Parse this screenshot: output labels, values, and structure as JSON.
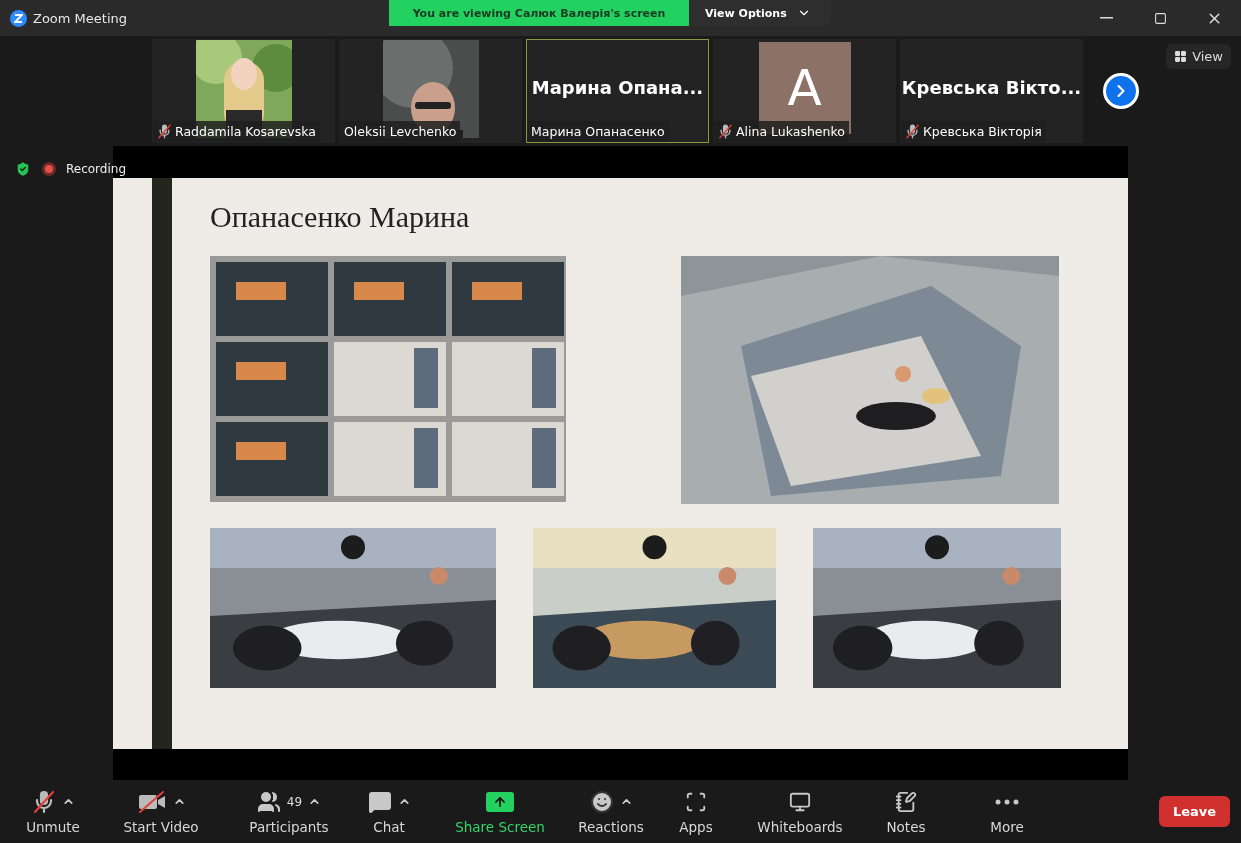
{
  "window": {
    "title": "Zoom Meeting"
  },
  "banner": {
    "text": "You are viewing Салюк Валерія's screen",
    "options_label": "View Options"
  },
  "participants": [
    {
      "name": "Raddamila Kosarevska",
      "muted": true,
      "speaking": false
    },
    {
      "name": "Oleksii Levchenko",
      "muted": false,
      "speaking": false
    },
    {
      "name": "Марина Опанасенко",
      "kind": "name",
      "display": "Марина  Опана...",
      "muted": false,
      "speaking": true
    },
    {
      "name": "Alina Lukashenko",
      "kind": "avatar",
      "display": "A",
      "color": "#8c7167",
      "muted": true,
      "speaking": false
    },
    {
      "name": "Кревська Вікторія",
      "kind": "name",
      "display": "Кревська  Вікто...",
      "muted": true,
      "speaking": false
    }
  ],
  "view_button": "View",
  "recording": {
    "label": "Recording"
  },
  "slide": {
    "title": "Опанасенко Марина"
  },
  "toolbar": [
    {
      "label": "Unmute",
      "kind": "mic",
      "off": true,
      "caret": true
    },
    {
      "label": "Start Video",
      "kind": "video",
      "off": true,
      "caret": true
    },
    {
      "label": "Participants",
      "kind": "people",
      "count": "49",
      "caret": true
    },
    {
      "label": "Chat",
      "kind": "chat",
      "caret": true
    },
    {
      "label": "Share Screen",
      "kind": "share",
      "active": true,
      "caret": false
    },
    {
      "label": "Reactions",
      "kind": "reactions",
      "caret": true
    },
    {
      "label": "Apps",
      "kind": "apps",
      "caret": false
    },
    {
      "label": "Whiteboards",
      "kind": "whiteboard",
      "caret": false
    },
    {
      "label": "Notes",
      "kind": "notes",
      "caret": false
    },
    {
      "label": "More",
      "kind": "more",
      "caret": false
    }
  ],
  "leave_button": "Leave"
}
